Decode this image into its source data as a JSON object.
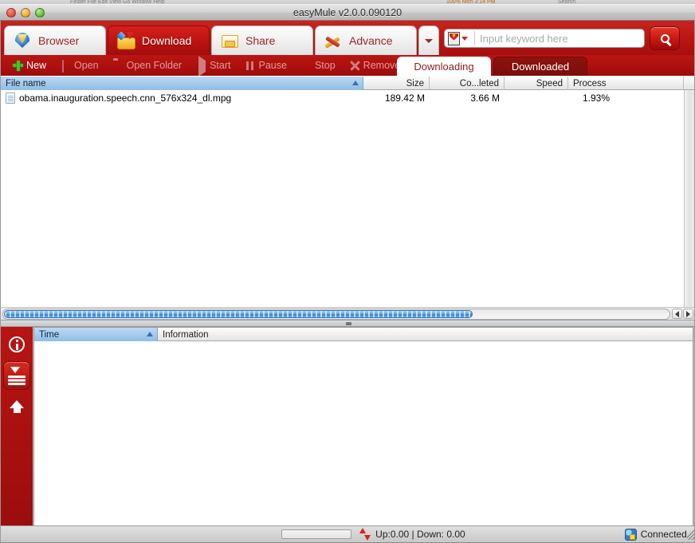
{
  "background_window": {
    "strip_left": "Finder File Edit View Go Window Help",
    "strip_mid": "100% Mon 3:14 PM",
    "strip_right": "Search"
  },
  "window": {
    "title": "easyMule v2.0.0.090120",
    "controls": {
      "close": "close-button",
      "minimize": "minimize-button",
      "zoom": "zoom-button"
    }
  },
  "main_tabs": [
    {
      "label": "Browser",
      "icon": "browser-shield-icon",
      "active": false
    },
    {
      "label": "Download",
      "icon": "download-folder-icon",
      "active": true
    },
    {
      "label": "Share",
      "icon": "share-tray-icon",
      "active": false
    },
    {
      "label": "Advance",
      "icon": "advance-tools-icon",
      "active": false
    }
  ],
  "tab_overflow": {
    "icon": "chevron-down-icon"
  },
  "search": {
    "source_icon": "emule-logo-icon",
    "dropdown_icon": "chevron-down-icon",
    "placeholder": "Input keyword here",
    "value": "",
    "button_icon": "search-magnifier-icon"
  },
  "toolbar": {
    "actions": [
      {
        "label": "New",
        "icon": "plus-icon",
        "enabled": true
      },
      {
        "label": "Open",
        "icon": "document-icon",
        "enabled": false
      },
      {
        "label": "Open Folder",
        "icon": "folder-icon",
        "enabled": false
      },
      {
        "label": "Start",
        "icon": "play-icon",
        "enabled": false
      },
      {
        "label": "Pause",
        "icon": "pause-icon",
        "enabled": false
      },
      {
        "label": "Stop",
        "icon": "stop-icon",
        "enabled": false
      },
      {
        "label": "Remove",
        "icon": "close-x-icon",
        "enabled": false
      }
    ]
  },
  "sub_tabs": [
    {
      "label": "Downloading",
      "active": true
    },
    {
      "label": "Downloaded",
      "active": false
    }
  ],
  "file_list": {
    "columns": [
      {
        "label": "File name",
        "sorted": true,
        "sort_dir": "asc"
      },
      {
        "label": "Size",
        "sorted": false
      },
      {
        "label": "Co...leted",
        "sorted": false
      },
      {
        "label": "Speed",
        "sorted": false
      },
      {
        "label": "Process",
        "sorted": false
      }
    ],
    "rows": [
      {
        "icon": "file-document-icon",
        "name": "obama.inauguration.speech.cnn_576x324_dl.mpg",
        "size": "189.42 M",
        "completed": "3.66 M",
        "speed": "",
        "process": "1.93%"
      }
    ],
    "hscrollbar": {
      "left_arrow": "arrow-left-icon",
      "right_arrow": "arrow-right-icon"
    }
  },
  "sidebar": {
    "items": [
      {
        "name": "info",
        "icon": "info-circle-icon",
        "selected": false
      },
      {
        "name": "download",
        "icon": "download-list-icon",
        "selected": true
      },
      {
        "name": "upload",
        "icon": "upload-arrow-icon",
        "selected": false
      }
    ]
  },
  "log_panel": {
    "columns": [
      {
        "label": "Time",
        "sorted": true,
        "sort_dir": "asc"
      },
      {
        "label": "Information",
        "sorted": false
      }
    ],
    "rows": []
  },
  "status_bar": {
    "progress_value": 0,
    "transfer_icon": "up-down-arrows-icon",
    "transfer_text": "Up:0.00 | Down: 0.00",
    "connection_icon": "network-globe-icon",
    "connection_text": "Connected",
    "resize_grip": "resize-grip-icon"
  },
  "colors": {
    "brand_red": "#b81513",
    "toolbar_red": "#a9110f",
    "accent_blue": "#8fbde6",
    "active_tab_bg": "#ffffff"
  }
}
